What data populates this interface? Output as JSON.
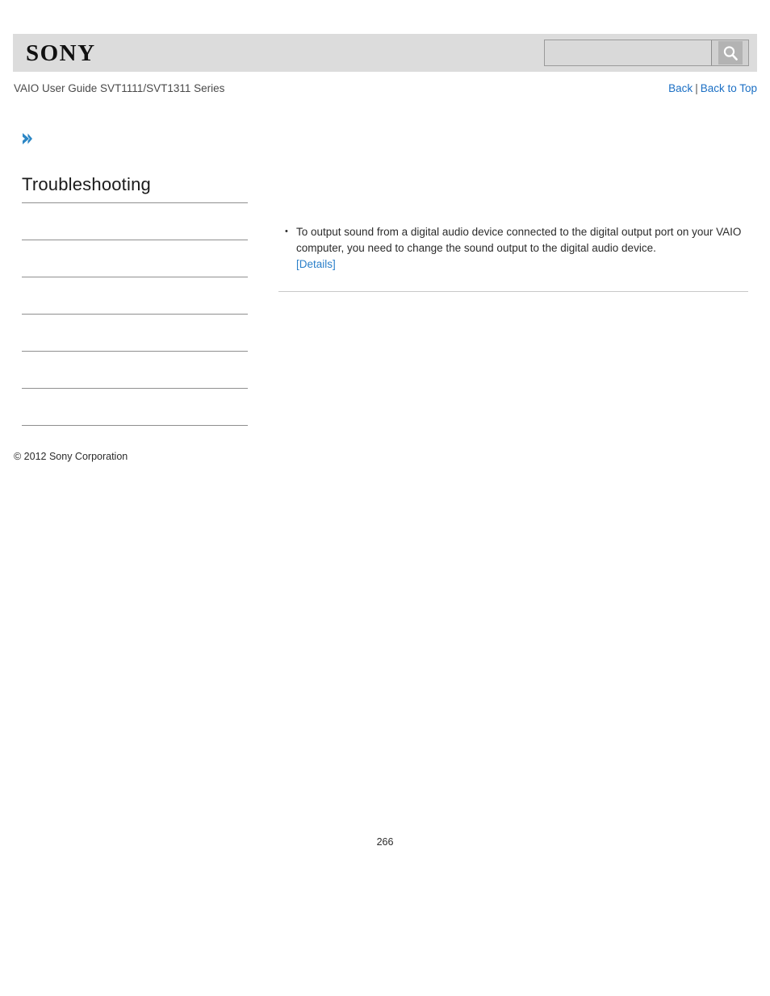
{
  "header": {
    "brand_logo_text": "SONY",
    "search": {
      "value": "",
      "placeholder": "",
      "button_icon": "search-icon"
    },
    "guide_title": "VAIO User Guide SVT1111/SVT1311 Series",
    "nav": {
      "back_label": "Back",
      "separator": "|",
      "back_to_top_label": "Back to Top"
    }
  },
  "marker": {
    "icon": "chevron-right-icon",
    "color": "#2b86c5"
  },
  "sidebar": {
    "title": "Troubleshooting",
    "items": [
      {
        "label": ""
      },
      {
        "label": ""
      },
      {
        "label": ""
      },
      {
        "label": ""
      },
      {
        "label": ""
      },
      {
        "label": ""
      }
    ]
  },
  "main": {
    "bullets": [
      {
        "text": "To output sound from a digital audio device connected to the digital output port on your VAIO computer, you need to change the sound output to the digital audio device.",
        "link_label": "[Details]"
      }
    ]
  },
  "footer": {
    "copyright": "© 2012 Sony Corporation",
    "page_number": "266"
  },
  "colors": {
    "header_bar": "#dcdcdc",
    "link_blue": "#1b6fc4",
    "details_blue": "#2a7fc9",
    "rule_gray": "#8f8f8f",
    "content_rule_gray": "#c9c9c9"
  }
}
